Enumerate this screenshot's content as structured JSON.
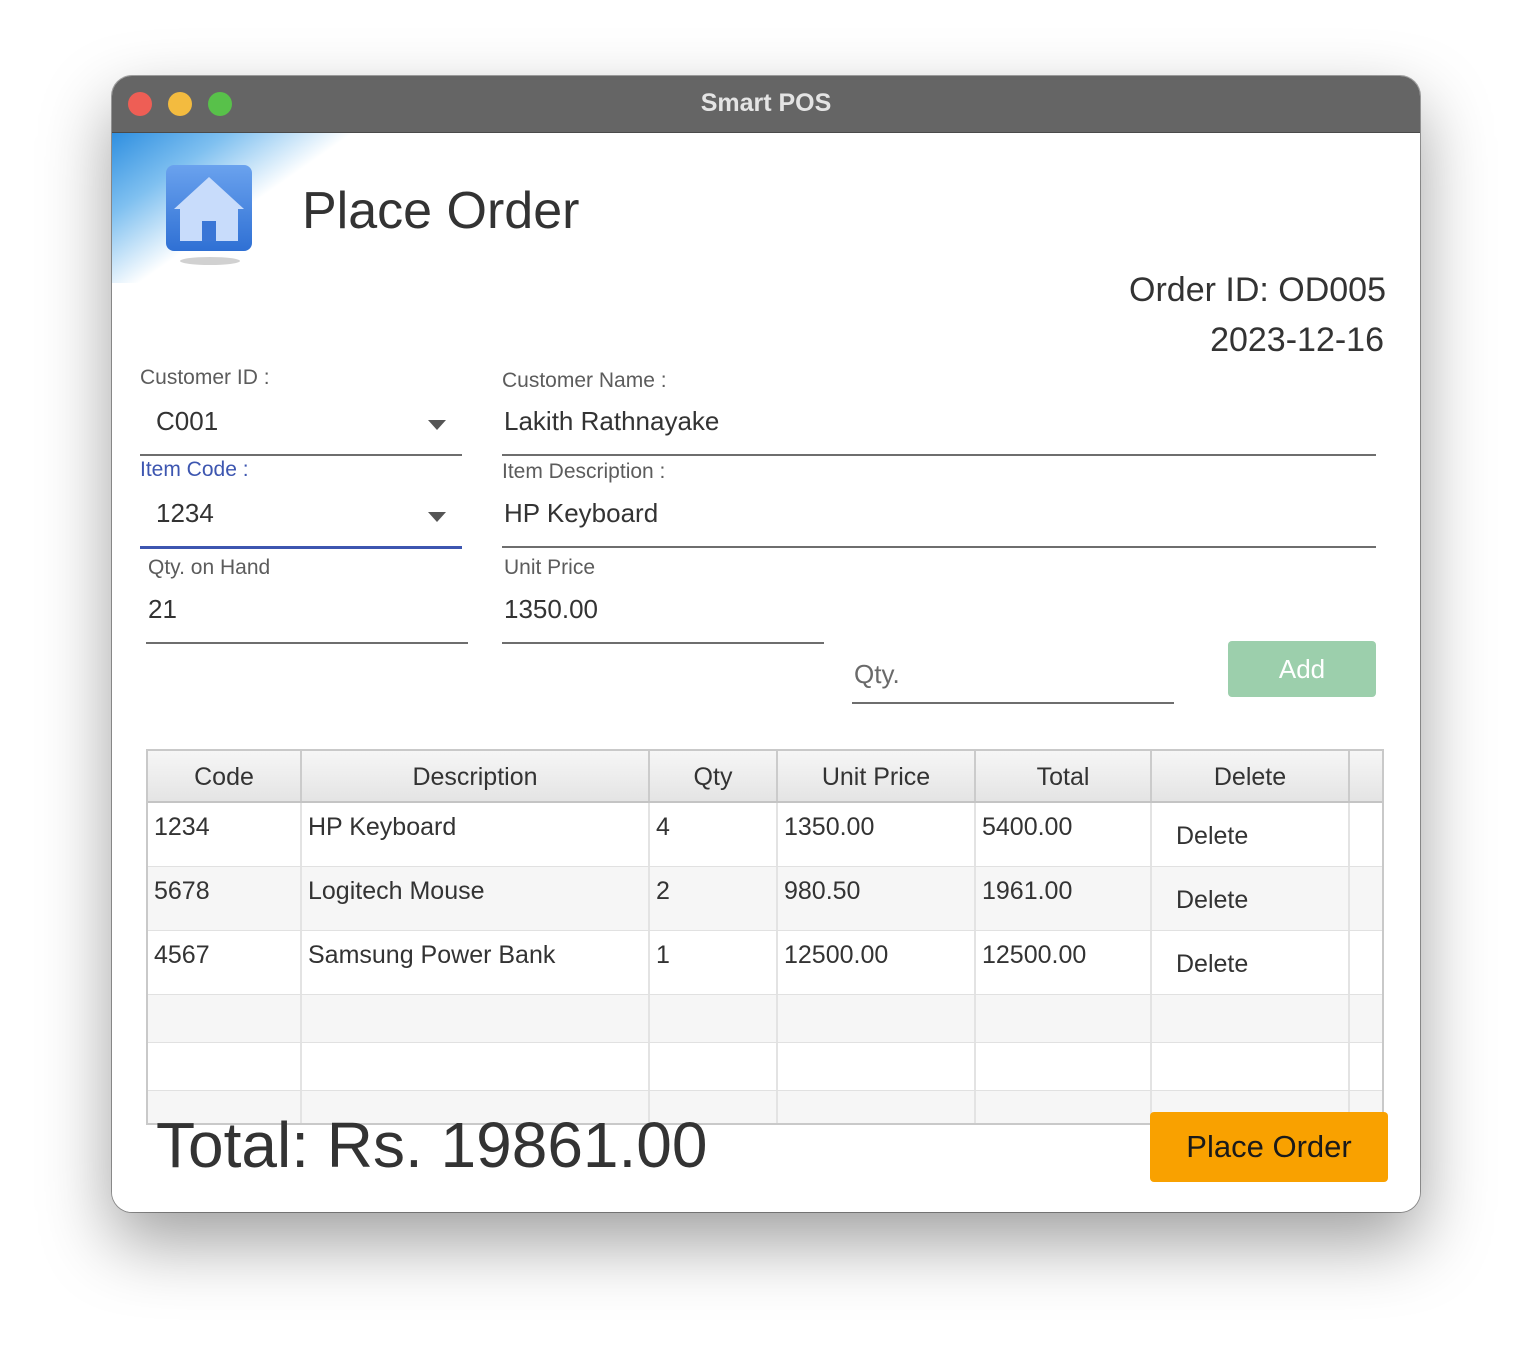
{
  "window": {
    "title": "Smart POS",
    "controls": [
      "close",
      "minimize",
      "zoom"
    ]
  },
  "header": {
    "icon": "home-icon",
    "title": "Place Order",
    "order_id_label": "Order ID: OD005",
    "date": "2023-12-16"
  },
  "form": {
    "customer_id": {
      "label": "Customer ID :",
      "value": "C001"
    },
    "customer_name": {
      "label": "Customer Name :",
      "value": "Lakith Rathnayake"
    },
    "item_code": {
      "label": "Item Code :",
      "value": "1234",
      "focused": true
    },
    "item_description": {
      "label": "Item Description :",
      "value": "HP Keyboard"
    },
    "qty_on_hand": {
      "label": "Qty. on Hand",
      "value": "21"
    },
    "unit_price": {
      "label": "Unit Price",
      "value": "1350.00"
    },
    "qty": {
      "placeholder": "Qty.",
      "value": ""
    },
    "add_button": "Add"
  },
  "table": {
    "columns": [
      "Code",
      "Description",
      "Qty",
      "Unit Price",
      "Total",
      "Delete"
    ],
    "rows": [
      {
        "code": "1234",
        "description": "HP Keyboard",
        "qty": "4",
        "unit_price": "1350.00",
        "total": "5400.00",
        "delete": "Delete"
      },
      {
        "code": "5678",
        "description": "Logitech Mouse",
        "qty": "2",
        "unit_price": "980.50",
        "total": "1961.00",
        "delete": "Delete"
      },
      {
        "code": "4567",
        "description": "Samsung Power Bank",
        "qty": "1",
        "unit_price": "12500.00",
        "total": "12500.00",
        "delete": "Delete"
      }
    ]
  },
  "footer": {
    "total_label": "Total: Rs. 19861.00",
    "place_order_button": "Place Order"
  },
  "colors": {
    "titlebar": "#656565",
    "focus_accent": "#3d56b0",
    "add_button": "#9ccfac",
    "place_order_button": "#f9a100"
  }
}
